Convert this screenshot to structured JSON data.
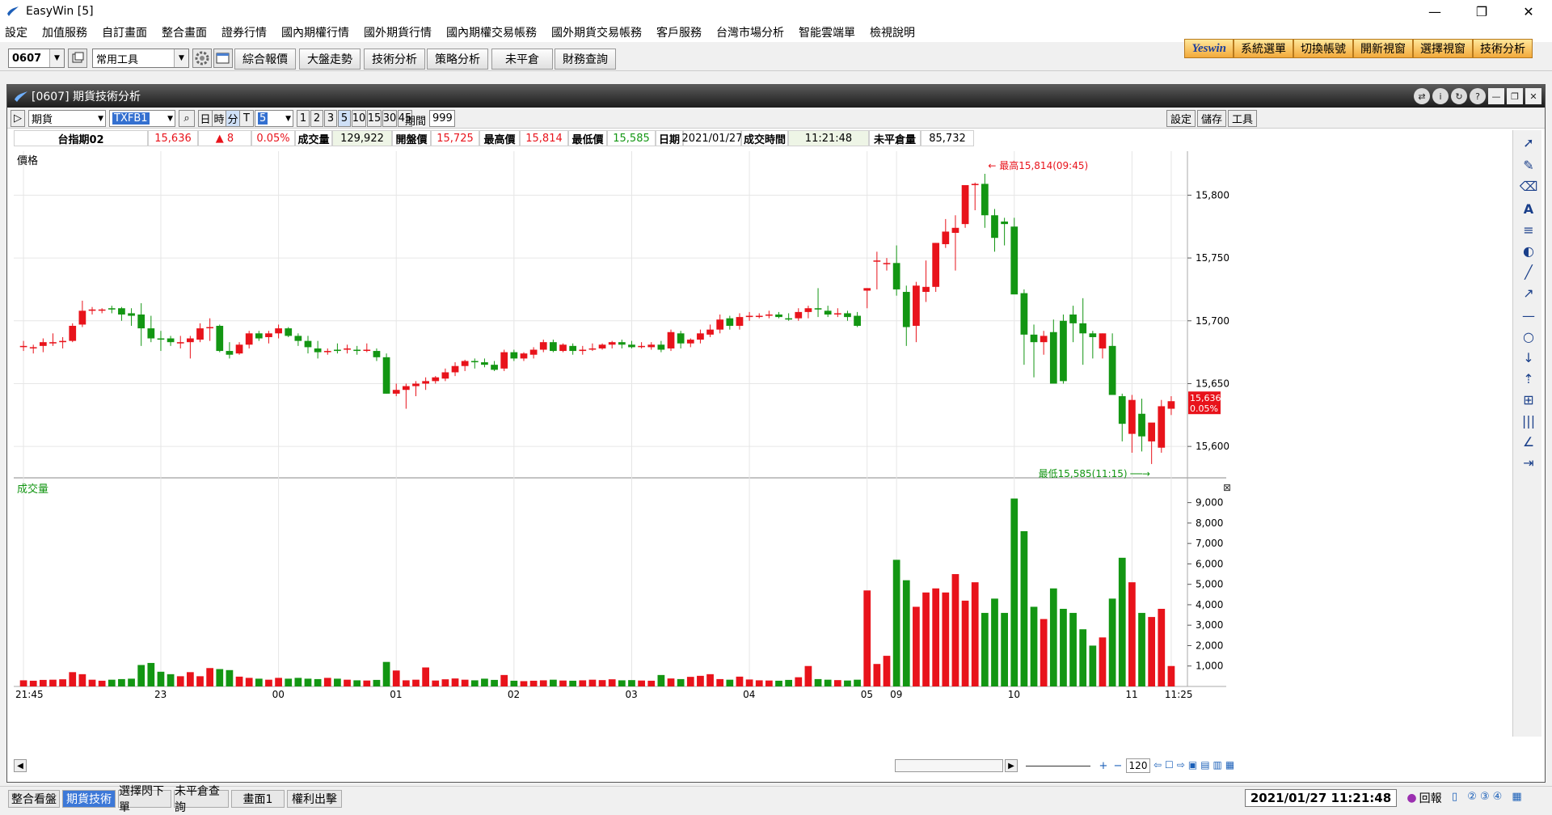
{
  "app": {
    "title": "EasyWin  [5]"
  },
  "menu": [
    "設定",
    "加值服務",
    "自訂畫面",
    "整合畫面",
    "證券行情",
    "國內期權行情",
    "國外期貨行情",
    "國內期權交易帳務",
    "國外期貨交易帳務",
    "客戶服務",
    "台灣市場分析",
    "智能雲端單",
    "檢視說明"
  ],
  "toolbar": {
    "code": "0607",
    "tools": "常用工具",
    "buttons": [
      "綜合報價",
      "大盤走勢",
      "技術分析",
      "策略分析",
      "未平倉",
      "財務查詢"
    ]
  },
  "brandbar": {
    "logo": "Yeswin",
    "items": [
      "系統選單",
      "切換帳號",
      "開新視窗",
      "選擇視窗",
      "技術分析"
    ]
  },
  "window": {
    "title": "[0607] 期貨技術分析"
  },
  "subtool": {
    "market": "期貨",
    "symbol": "TXFB1",
    "k_types": [
      "日",
      "時",
      "分",
      "T"
    ],
    "interval": "5",
    "presets": [
      "1",
      "2",
      "3",
      "5",
      "10",
      "15",
      "30",
      "45"
    ],
    "period_label": "期間",
    "period": "999",
    "right": [
      "設定",
      "儲存",
      "工具"
    ]
  },
  "quote": {
    "name": "台指期02",
    "price": "15,636",
    "change": "▲ 8",
    "pct": "0.05%",
    "vol_label": "成交量",
    "vol": "129,922",
    "open_label": "開盤價",
    "open": "15,725",
    "high_label": "最高價",
    "high": "15,814",
    "low_label": "最低價",
    "low": "15,585",
    "date_label": "日期",
    "date": "2021/01/27",
    "time_label": "成交時間",
    "time": "11:21:48",
    "oi_label": "未平倉量",
    "oi": "85,732"
  },
  "chart_data": {
    "type": "candlestick",
    "price_label": "價格",
    "volume_label": "成交量",
    "price_ticks": [
      15600,
      15650,
      15700,
      15750,
      15800
    ],
    "price_tick_labels": [
      "15,600",
      "15,650",
      "15,700",
      "15,750",
      "15,800"
    ],
    "ylim": [
      15575,
      15835
    ],
    "volume_ticks": [
      1000,
      2000,
      3000,
      4000,
      5000,
      6000,
      7000,
      8000,
      9000
    ],
    "volume_tick_labels": [
      "1,000",
      "2,000",
      "3,000",
      "4,000",
      "5,000",
      "6,000",
      "7,000",
      "8,000",
      "9,000"
    ],
    "volume_ylim": [
      0,
      9500
    ],
    "x_labels": [
      {
        "i": 0,
        "t": "21:45"
      },
      {
        "i": 14,
        "t": "23"
      },
      {
        "i": 26,
        "t": "00"
      },
      {
        "i": 38,
        "t": "01"
      },
      {
        "i": 50,
        "t": "02"
      },
      {
        "i": 62,
        "t": "03"
      },
      {
        "i": 74,
        "t": "04"
      },
      {
        "i": 86,
        "t": "05"
      },
      {
        "i": 89,
        "t": "09"
      },
      {
        "i": 101,
        "t": "10"
      },
      {
        "i": 113,
        "t": "11"
      },
      {
        "i": 117,
        "t": "11:25"
      }
    ],
    "high_note": "最高15,814(09:45)",
    "low_note": "最低15,585(11:15)",
    "last_label": [
      "15,636",
      "0.05%"
    ],
    "colors": {
      "up": "#e8131b",
      "down": "#139613"
    },
    "candles": [
      [
        15680,
        15684,
        15676,
        15680,
        300
      ],
      [
        15679,
        15681,
        15674,
        15679,
        280
      ],
      [
        15680,
        15686,
        15675,
        15683,
        320
      ],
      [
        15682,
        15690,
        15680,
        15683,
        330
      ],
      [
        15683,
        15687,
        15678,
        15684,
        350
      ],
      [
        15684,
        15698,
        15683,
        15696,
        700
      ],
      [
        15697,
        15716,
        15695,
        15708,
        600
      ],
      [
        15708,
        15711,
        15705,
        15709,
        330
      ],
      [
        15709,
        15710,
        15706,
        15709,
        280
      ],
      [
        15710,
        15712,
        15706,
        15709,
        330
      ],
      [
        15710,
        15711,
        15700,
        15705,
        360
      ],
      [
        15706,
        15710,
        15696,
        15704,
        380
      ],
      [
        15705,
        15714,
        15680,
        15694,
        1050
      ],
      [
        15694,
        15704,
        15683,
        15686,
        1150
      ],
      [
        15686,
        15692,
        15676,
        15685,
        720
      ],
      [
        15686,
        15688,
        15680,
        15683,
        600
      ],
      [
        15682,
        15688,
        15678,
        15683,
        500
      ],
      [
        15683,
        15688,
        15670,
        15686,
        700
      ],
      [
        15685,
        15698,
        15683,
        15694,
        500
      ],
      [
        15695,
        15702,
        15684,
        15695,
        900
      ],
      [
        15696,
        15697,
        15675,
        15676,
        850
      ],
      [
        15676,
        15683,
        15670,
        15673,
        800
      ],
      [
        15674,
        15683,
        15673,
        15681,
        480
      ],
      [
        15681,
        15692,
        15678,
        15690,
        420
      ],
      [
        15690,
        15692,
        15684,
        15686,
        380
      ],
      [
        15687,
        15692,
        15682,
        15690,
        330
      ],
      [
        15690,
        15697,
        15686,
        15694,
        420
      ],
      [
        15694,
        15695,
        15687,
        15688,
        380
      ],
      [
        15688,
        15690,
        15680,
        15684,
        420
      ],
      [
        15684,
        15688,
        15674,
        15679,
        380
      ],
      [
        15678,
        15684,
        15670,
        15675,
        360
      ],
      [
        15676,
        15678,
        15673,
        15676,
        420
      ],
      [
        15677,
        15682,
        15674,
        15676,
        380
      ],
      [
        15677,
        15681,
        15674,
        15678,
        330
      ],
      [
        15677,
        15680,
        15673,
        15676,
        300
      ],
      [
        15677,
        15682,
        15675,
        15677,
        290
      ],
      [
        15676,
        15678,
        15668,
        15671,
        320
      ],
      [
        15671,
        15674,
        15642,
        15642,
        1200
      ],
      [
        15642,
        15650,
        15640,
        15645,
        780
      ],
      [
        15645,
        15650,
        15630,
        15648,
        300
      ],
      [
        15648,
        15652,
        15640,
        15650,
        330
      ],
      [
        15650,
        15655,
        15645,
        15652,
        930
      ],
      [
        15652,
        15656,
        15650,
        15655,
        290
      ],
      [
        15654,
        15662,
        15652,
        15659,
        350
      ],
      [
        15659,
        15667,
        15656,
        15664,
        390
      ],
      [
        15664,
        15669,
        15660,
        15668,
        330
      ],
      [
        15668,
        15670,
        15662,
        15667,
        300
      ],
      [
        15667,
        15670,
        15663,
        15665,
        380
      ],
      [
        15665,
        15668,
        15660,
        15661,
        320
      ],
      [
        15662,
        15677,
        15660,
        15675,
        560
      ],
      [
        15675,
        15677,
        15668,
        15670,
        280
      ],
      [
        15670,
        15675,
        15668,
        15674,
        260
      ],
      [
        15673,
        15679,
        15670,
        15677,
        280
      ],
      [
        15677,
        15685,
        15675,
        15683,
        300
      ],
      [
        15683,
        15685,
        15675,
        15676,
        330
      ],
      [
        15676,
        15682,
        15675,
        15681,
        290
      ],
      [
        15680,
        15682,
        15673,
        15676,
        280
      ],
      [
        15676,
        15680,
        15673,
        15677,
        300
      ],
      [
        15678,
        15682,
        15676,
        15678,
        330
      ],
      [
        15678,
        15682,
        15677,
        15681,
        310
      ],
      [
        15681,
        15684,
        15678,
        15683,
        350
      ],
      [
        15683,
        15685,
        15678,
        15681,
        300
      ],
      [
        15681,
        15684,
        15678,
        15679,
        310
      ],
      [
        15680,
        15683,
        15678,
        15680,
        290
      ],
      [
        15679,
        15683,
        15677,
        15681,
        280
      ],
      [
        15681,
        15684,
        15675,
        15677,
        560
      ],
      [
        15678,
        15693,
        15676,
        15691,
        390
      ],
      [
        15690,
        15692,
        15678,
        15682,
        360
      ],
      [
        15682,
        15686,
        15679,
        15685,
        470
      ],
      [
        15685,
        15693,
        15682,
        15690,
        520
      ],
      [
        15689,
        15697,
        15687,
        15693,
        600
      ],
      [
        15693,
        15705,
        15690,
        15701,
        360
      ],
      [
        15702,
        15704,
        15693,
        15696,
        330
      ],
      [
        15696,
        15706,
        15693,
        15703,
        480
      ],
      [
        15703,
        15707,
        15700,
        15704,
        340
      ],
      [
        15704,
        15706,
        15702,
        15704,
        300
      ],
      [
        15705,
        15708,
        15702,
        15705,
        290
      ],
      [
        15705,
        15707,
        15702,
        15703,
        280
      ],
      [
        15702,
        15706,
        15700,
        15701,
        320
      ],
      [
        15702,
        15710,
        15700,
        15707,
        450
      ],
      [
        15707,
        15712,
        15702,
        15710,
        1000
      ],
      [
        15710,
        15726,
        15703,
        15709,
        360
      ],
      [
        15708,
        15712,
        15703,
        15705,
        330
      ],
      [
        15706,
        15710,
        15703,
        15706,
        310
      ],
      [
        15706,
        15708,
        15700,
        15703,
        290
      ],
      [
        15704,
        15707,
        15695,
        15696,
        330
      ],
      [
        15724,
        15726,
        15710,
        15726,
        4700
      ],
      [
        15748,
        15755,
        15725,
        15748,
        1100
      ],
      [
        15746,
        15750,
        15740,
        15746,
        1500
      ],
      [
        15746,
        15760,
        15720,
        15725,
        6200
      ],
      [
        15723,
        15728,
        15680,
        15695,
        5200
      ],
      [
        15696,
        15731,
        15683,
        15728,
        3900
      ],
      [
        15723,
        15748,
        15715,
        15727,
        4600
      ],
      [
        15727,
        15762,
        15723,
        15762,
        4800
      ],
      [
        15761,
        15781,
        15758,
        15771,
        4600
      ],
      [
        15770,
        15784,
        15740,
        15774,
        5500
      ],
      [
        15777,
        15804,
        15774,
        15808,
        4200
      ],
      [
        15808,
        15810,
        15788,
        15809,
        5100
      ],
      [
        15809,
        15817,
        15774,
        15784,
        3600
      ],
      [
        15784,
        15789,
        15755,
        15766,
        4300
      ],
      [
        15779,
        15782,
        15760,
        15777,
        3600
      ],
      [
        15775,
        15782,
        15725,
        15721,
        9200
      ],
      [
        15722,
        15725,
        15665,
        15689,
        7600
      ],
      [
        15689,
        15697,
        15655,
        15683,
        3900
      ],
      [
        15683,
        15692,
        15673,
        15688,
        3300
      ],
      [
        15691,
        15701,
        15652,
        15650,
        4800
      ],
      [
        15700,
        15705,
        15650,
        15652,
        3800
      ],
      [
        15705,
        15712,
        15683,
        15698,
        3600
      ],
      [
        15698,
        15718,
        15665,
        15690,
        2800
      ],
      [
        15690,
        15692,
        15670,
        15687,
        2000
      ],
      [
        15678,
        15690,
        15670,
        15690,
        2400
      ],
      [
        15680,
        15690,
        15648,
        15641,
        4300
      ],
      [
        15640,
        15642,
        15604,
        15618,
        6300
      ],
      [
        15610,
        15641,
        15595,
        15637,
        5100
      ],
      [
        15626,
        15638,
        15596,
        15608,
        3600
      ],
      [
        15604,
        15613,
        15586,
        15619,
        3400
      ],
      [
        15599,
        15637,
        15595,
        15632,
        3800
      ],
      [
        15630,
        15640,
        15625,
        15636,
        1000
      ]
    ]
  },
  "scroll": {
    "zoom": "120"
  },
  "tabs": [
    "整合看盤",
    "期貨技術",
    "選擇閃下單",
    "未平倉查詢",
    "畫面1",
    "權利出擊"
  ],
  "status": {
    "datetime": "2021/01/27 11:21:48",
    "echo": "回報"
  }
}
